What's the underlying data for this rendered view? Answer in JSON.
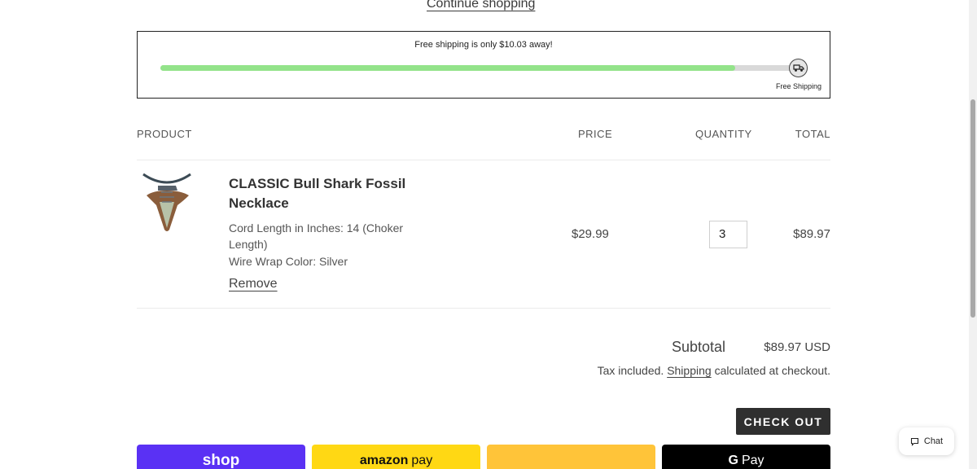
{
  "continue_link": "Continue shopping",
  "shipping_bar": {
    "message_prefix": "Free shipping",
    "message_suffix": "is only $10.03 away!",
    "goal_label": "Free Shipping",
    "progress_fraction": 0.9,
    "fill_color": "#93e38a"
  },
  "table": {
    "headers": {
      "product": "PRODUCT",
      "price": "PRICE",
      "quantity": "QUANTITY",
      "total": "TOTAL"
    },
    "items": [
      {
        "name": "CLASSIC Bull Shark Fossil Necklace",
        "option1": "Cord Length in Inches: 14 (Choker Length)",
        "option2": "Wire Wrap Color: Silver",
        "remove_label": "Remove",
        "price": "$29.99",
        "quantity": "3",
        "total": "$89.97"
      }
    ]
  },
  "summary": {
    "subtotal_label": "Subtotal",
    "subtotal_value": "$89.97 USD",
    "tax_prefix": "Tax included.",
    "tax_link": "Shipping",
    "tax_suffix": "calculated at checkout."
  },
  "checkout_label": "CHECK OUT",
  "payments": {
    "shop": "shop",
    "amazon_brand": "amazon",
    "amazon_pay": "pay",
    "gpay_g": "G",
    "gpay_pay": "Pay"
  },
  "chat_label": "Chat"
}
